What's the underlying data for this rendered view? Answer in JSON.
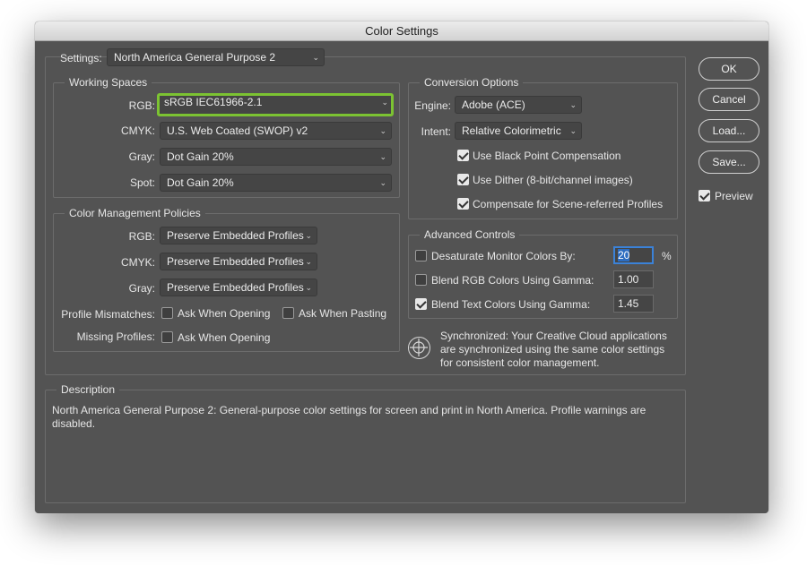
{
  "window": {
    "title": "Color Settings"
  },
  "settings": {
    "label": "Settings:",
    "value": "North America General Purpose 2"
  },
  "working_spaces": {
    "title": "Working Spaces",
    "rgb": {
      "label": "RGB:",
      "value": "sRGB IEC61966-2.1"
    },
    "cmyk": {
      "label": "CMYK:",
      "value": "U.S. Web Coated (SWOP) v2"
    },
    "gray": {
      "label": "Gray:",
      "value": "Dot Gain 20%"
    },
    "spot": {
      "label": "Spot:",
      "value": "Dot Gain 20%"
    }
  },
  "policies": {
    "title": "Color Management Policies",
    "rgb": {
      "label": "RGB:",
      "value": "Preserve Embedded Profiles"
    },
    "cmyk": {
      "label": "CMYK:",
      "value": "Preserve Embedded Profiles"
    },
    "gray": {
      "label": "Gray:",
      "value": "Preserve Embedded Profiles"
    },
    "mismatches_label": "Profile Mismatches:",
    "ask_opening": "Ask When Opening",
    "ask_pasting": "Ask When Pasting",
    "missing_label": "Missing Profiles:",
    "missing_ask_opening": "Ask When Opening"
  },
  "conversion": {
    "title": "Conversion Options",
    "engine": {
      "label": "Engine:",
      "value": "Adobe (ACE)"
    },
    "intent": {
      "label": "Intent:",
      "value": "Relative Colorimetric"
    },
    "black_point": "Use Black Point Compensation",
    "dither": "Use Dither (8-bit/channel images)",
    "scene_referred": "Compensate for Scene-referred Profiles"
  },
  "advanced": {
    "title": "Advanced Controls",
    "desaturate": {
      "label": "Desaturate Monitor Colors By:",
      "value": "20",
      "unit": "%"
    },
    "blend_rgb": {
      "label": "Blend RGB Colors Using Gamma:",
      "value": "1.00"
    },
    "blend_text": {
      "label": "Blend Text Colors Using Gamma:",
      "value": "1.45"
    }
  },
  "sync": {
    "line1": "Synchronized: Your Creative Cloud applications",
    "line2": "are synchronized using the same color settings",
    "line3": "for consistent color management."
  },
  "description": {
    "title": "Description",
    "line1": "North America General Purpose 2:  General-purpose color settings for screen and print in North America. Profile warnings are",
    "line2": "disabled."
  },
  "buttons": {
    "ok": "OK",
    "cancel": "Cancel",
    "load": "Load...",
    "save": "Save...",
    "preview": "Preview"
  },
  "colors": {
    "dialog_bg": "#535353",
    "highlight": "#7cc332",
    "focus": "#3b82d8"
  }
}
